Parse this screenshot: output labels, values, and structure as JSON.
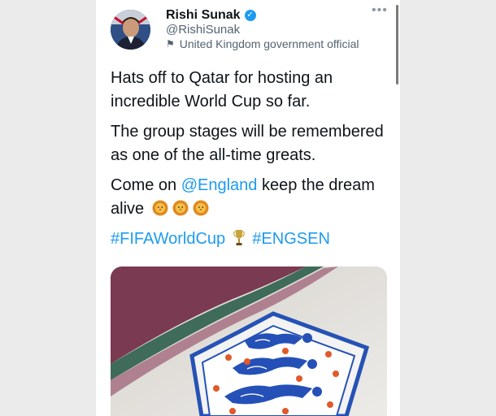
{
  "tweet": {
    "author_name": "Rishi Sunak",
    "handle": "@RishiSunak",
    "label": "United Kingdom government official",
    "more_glyph": "•••",
    "verified_glyph": "✓",
    "para1": "Hats off to Qatar for hosting an incredible World Cup so far.",
    "para2": "The group stages will be remembered as one of the all-time greats.",
    "para3_pre": "Come on ",
    "mention": "@England",
    "para3_post": " keep the dream alive",
    "hashtag1": "#FIFAWorldCup",
    "hashtag2": "#ENGSEN",
    "lion_emoji_count": 3
  },
  "colors": {
    "link": "#1d9bf0",
    "text": "#0f1419",
    "secondary": "#536471"
  },
  "icons": [
    "verified-badge-icon",
    "more-options-icon",
    "government-flag-icon",
    "lion-face-emoji",
    "trophy-emoji"
  ]
}
